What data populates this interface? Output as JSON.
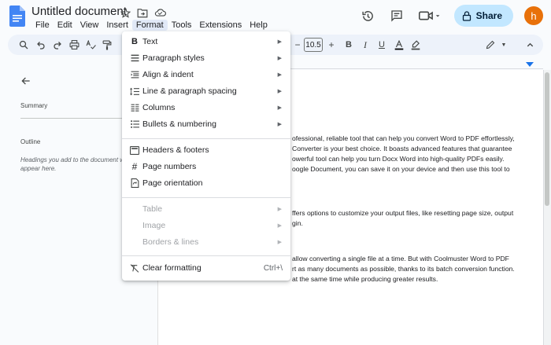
{
  "app": {
    "title": "Untitled document",
    "menus": [
      "File",
      "Edit",
      "View",
      "Insert",
      "Format",
      "Tools",
      "Extensions",
      "Help"
    ],
    "active_menu": "Format",
    "share_label": "Share",
    "avatar_letter": "h",
    "accent": "#1a73e8",
    "share_bg": "#c2e7ff",
    "avatar_bg": "#e8710a"
  },
  "toolbar": {
    "font_size": "10.5"
  },
  "sidebar": {
    "summary_label": "Summary",
    "outline_label": "Outline",
    "outline_hint": "Headings you add to the document will appear here."
  },
  "document": {
    "lines": [
      "ofessional, reliable tool that can help you convert Word to PDF effortlessly,",
      "Converter is your best choice. It boasts advanced features that guarantee",
      "owerful tool can help you turn Docx Word into high-quality PDFs easily.",
      "oogle Document, you can save it on your device and then use this tool to",
      "ffers options to customize your output files, like resetting page size, output",
      "gin.",
      "allow converting a single file at a time. But with Coolmuster Word to PDF",
      "rt as many documents as possible, thanks to its batch conversion function.",
      "at the same time while producing greater results."
    ]
  },
  "format_menu": {
    "items": [
      {
        "label": "Text",
        "icon": "bold-icon",
        "submenu": true,
        "disabled": false
      },
      {
        "label": "Paragraph styles",
        "icon": "paragraph-styles-icon",
        "submenu": true,
        "disabled": false
      },
      {
        "label": "Align & indent",
        "icon": "align-indent-icon",
        "submenu": true,
        "disabled": false
      },
      {
        "label": "Line & paragraph spacing",
        "icon": "line-spacing-icon",
        "submenu": true,
        "disabled": false
      },
      {
        "label": "Columns",
        "icon": "columns-icon",
        "submenu": true,
        "disabled": false
      },
      {
        "label": "Bullets & numbering",
        "icon": "bullets-icon",
        "submenu": true,
        "disabled": false
      },
      {
        "label": "Headers & footers",
        "icon": "headers-footers-icon",
        "submenu": false,
        "disabled": false
      },
      {
        "label": "Page numbers",
        "icon": "hash-icon",
        "submenu": false,
        "disabled": false
      },
      {
        "label": "Page orientation",
        "icon": "page-orientation-icon",
        "submenu": false,
        "disabled": false
      },
      {
        "label": "Table",
        "icon": "",
        "submenu": true,
        "disabled": true
      },
      {
        "label": "Image",
        "icon": "",
        "submenu": true,
        "disabled": true
      },
      {
        "label": "Borders & lines",
        "icon": "",
        "submenu": true,
        "disabled": true
      },
      {
        "label": "Clear formatting",
        "icon": "clear-formatting-icon",
        "submenu": false,
        "disabled": false,
        "shortcut": "Ctrl+\\"
      }
    ]
  }
}
